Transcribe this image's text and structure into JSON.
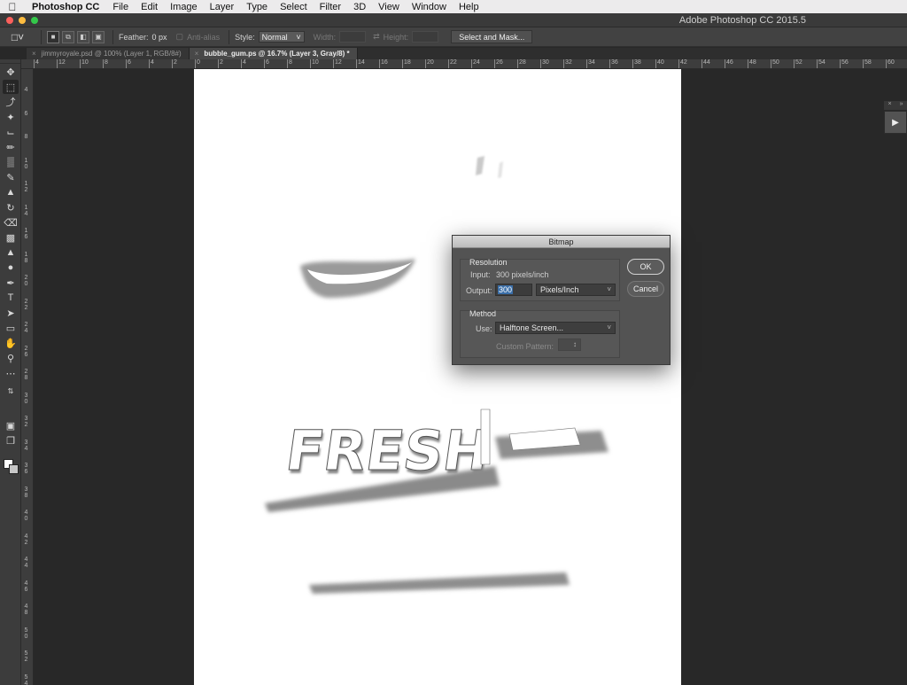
{
  "menubar": {
    "app_name": "Photoshop CC",
    "items": [
      "File",
      "Edit",
      "Image",
      "Layer",
      "Type",
      "Select",
      "Filter",
      "3D",
      "View",
      "Window",
      "Help"
    ]
  },
  "window": {
    "title": "Adobe Photoshop CC 2015.5"
  },
  "options": {
    "feather_label": "Feather:",
    "feather_value": "0 px",
    "antialias_label": "Anti-alias",
    "style_label": "Style:",
    "style_value": "Normal",
    "width_label": "Width:",
    "height_label": "Height:",
    "select_mask_label": "Select and Mask..."
  },
  "tabs": [
    {
      "label": "jimmyroyale.psd @ 100% (Layer 1, RGB/8#)",
      "active": false
    },
    {
      "label": "bubble_gum.ps @ 16.7% (Layer 3, Gray/8) *",
      "active": true
    }
  ],
  "ruler": {
    "top": [
      "4",
      "12",
      "10",
      "8",
      "6",
      "4",
      "2",
      "0",
      "2",
      "4",
      "6",
      "8",
      "10",
      "12",
      "14",
      "16",
      "18",
      "20",
      "22",
      "24",
      "26",
      "28",
      "30",
      "32",
      "34",
      "36",
      "38",
      "40",
      "42",
      "44",
      "46",
      "48",
      "50",
      "52",
      "54",
      "56",
      "58",
      "60"
    ],
    "left": [
      "4",
      "6",
      "8",
      "1 0",
      "1 2",
      "1 4",
      "1 6",
      "1 8",
      "2 0",
      "2 2",
      "2 4",
      "2 6",
      "2 8",
      "3 0",
      "3 2",
      "3 4",
      "3 6",
      "3 8",
      "4 0",
      "4 2",
      "4 4",
      "4 6",
      "4 8",
      "5 0",
      "5 2",
      "5 4"
    ]
  },
  "canvas": {
    "text": "FRESH"
  },
  "dialog": {
    "title": "Bitmap",
    "resolution_title": "Resolution",
    "input_label": "Input:",
    "input_value": "300 pixels/inch",
    "output_label": "Output:",
    "output_value": "300",
    "output_unit": "Pixels/Inch",
    "method_title": "Method",
    "use_label": "Use:",
    "use_value": "Halftone Screen...",
    "custom_pattern_label": "Custom Pattern:",
    "ok_label": "OK",
    "cancel_label": "Cancel"
  },
  "colors": {
    "accent_selection": "#3a6ea8",
    "canvas_bg": "#ffffff",
    "workspace_bg": "#282828"
  }
}
